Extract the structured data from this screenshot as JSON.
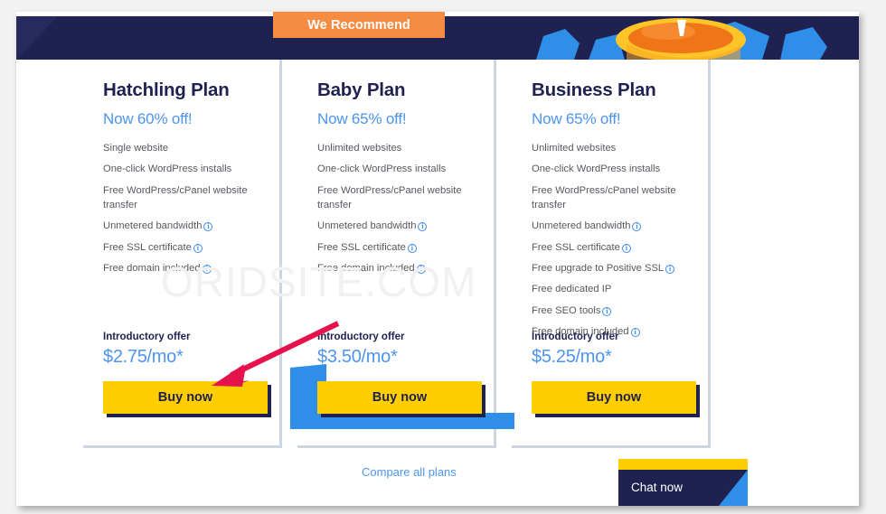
{
  "hero": {
    "art_description": "orange-ring-illustration"
  },
  "recommend_badge": {
    "label": "We Recommend"
  },
  "watermark": {
    "text": "ORIDSITE.COM"
  },
  "colors": {
    "navy": "#1f2250",
    "blue_link": "#4d94f0",
    "yellow": "#ffce00",
    "orange": "#f68b42",
    "ribbon_blue": "#2f8fe8",
    "arrow_red": "#e5124b"
  },
  "plans": [
    {
      "title": "Hatchling Plan",
      "discount": "Now 60% off!",
      "features": [
        {
          "text": "Single website",
          "info": false
        },
        {
          "text": "One-click WordPress installs",
          "info": false
        },
        {
          "text": "Free WordPress/cPanel website transfer",
          "info": false
        },
        {
          "text": "Unmetered bandwidth",
          "info": true
        },
        {
          "text": "Free SSL certificate",
          "info": true
        },
        {
          "text": "Free domain included",
          "info": true
        }
      ],
      "intro_label": "Introductory offer",
      "price": "$2.75/mo*",
      "buy_label": "Buy now",
      "featured": false
    },
    {
      "title": "Baby Plan",
      "discount": "Now 65% off!",
      "features": [
        {
          "text": "Unlimited websites",
          "info": false
        },
        {
          "text": "One-click WordPress installs",
          "info": false
        },
        {
          "text": "Free WordPress/cPanel website transfer",
          "info": false
        },
        {
          "text": "Unmetered bandwidth",
          "info": true
        },
        {
          "text": "Free SSL certificate",
          "info": true
        },
        {
          "text": "Free domain included",
          "info": true
        }
      ],
      "intro_label": "Introductory offer",
      "price": "$3.50/mo*",
      "buy_label": "Buy now",
      "featured": true
    },
    {
      "title": "Business Plan",
      "discount": "Now 65% off!",
      "features": [
        {
          "text": "Unlimited websites",
          "info": false
        },
        {
          "text": "One-click WordPress installs",
          "info": false
        },
        {
          "text": "Free WordPress/cPanel website transfer",
          "info": false
        },
        {
          "text": "Unmetered bandwidth",
          "info": true
        },
        {
          "text": "Free SSL certificate",
          "info": true
        },
        {
          "text": "Free upgrade to Positive SSL",
          "info": true
        },
        {
          "text": "Free dedicated IP",
          "info": false
        },
        {
          "text": "Free SEO tools",
          "info": true
        },
        {
          "text": "Free domain included",
          "info": true
        }
      ],
      "intro_label": "Introductory offer",
      "price": "$5.25/mo*",
      "buy_label": "Buy now",
      "featured": false
    }
  ],
  "footer": {
    "compare_link": "Compare all plans"
  },
  "chat": {
    "label": "Chat now"
  }
}
